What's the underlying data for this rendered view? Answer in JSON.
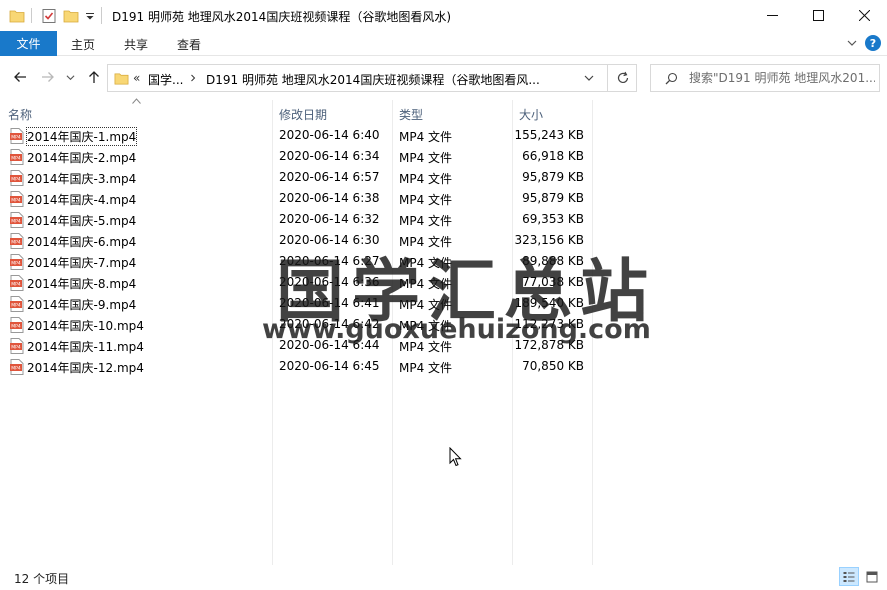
{
  "window": {
    "title": "D191 明师苑 地理风水2014国庆班视频课程（谷歌地图看风水)"
  },
  "ribbon": {
    "tabs": [
      "文件",
      "主页",
      "共享",
      "查看"
    ]
  },
  "address": {
    "overflow": "«",
    "crumbs": [
      "国学...",
      "D191 明师苑 地理风水2014国庆班视频课程（谷歌地图看风..."
    ]
  },
  "search": {
    "placeholder": "搜索\"D191 明师苑 地理风水201..."
  },
  "columns": {
    "name": "名称",
    "date": "修改日期",
    "type": "类型",
    "size": "大小"
  },
  "files": [
    {
      "name": "2014年国庆-1.mp4",
      "date": "2020-06-14 6:40",
      "type": "MP4 文件",
      "size": "155,243 KB"
    },
    {
      "name": "2014年国庆-2.mp4",
      "date": "2020-06-14 6:34",
      "type": "MP4 文件",
      "size": "66,918 KB"
    },
    {
      "name": "2014年国庆-3.mp4",
      "date": "2020-06-14 6:57",
      "type": "MP4 文件",
      "size": "95,879 KB"
    },
    {
      "name": "2014年国庆-4.mp4",
      "date": "2020-06-14 6:38",
      "type": "MP4 文件",
      "size": "95,879 KB"
    },
    {
      "name": "2014年国庆-5.mp4",
      "date": "2020-06-14 6:32",
      "type": "MP4 文件",
      "size": "69,353 KB"
    },
    {
      "name": "2014年国庆-6.mp4",
      "date": "2020-06-14 6:30",
      "type": "MP4 文件",
      "size": "323,156 KB"
    },
    {
      "name": "2014年国庆-7.mp4",
      "date": "2020-06-14 6:27",
      "type": "MP4 文件",
      "size": "89,888 KB"
    },
    {
      "name": "2014年国庆-8.mp4",
      "date": "2020-06-14 6:36",
      "type": "MP4 文件",
      "size": "77,038 KB"
    },
    {
      "name": "2014年国庆-9.mp4",
      "date": "2020-06-14 6:41",
      "type": "MP4 文件",
      "size": "189,540 KB"
    },
    {
      "name": "2014年国庆-10.mp4",
      "date": "2020-06-14 6:42",
      "type": "MP4 文件",
      "size": "112,273 KB"
    },
    {
      "name": "2014年国庆-11.mp4",
      "date": "2020-06-14 6:44",
      "type": "MP4 文件",
      "size": "172,878 KB"
    },
    {
      "name": "2014年国庆-12.mp4",
      "date": "2020-06-14 6:45",
      "type": "MP4 文件",
      "size": "70,850 KB"
    }
  ],
  "watermark": {
    "chinese": "国学汇总站",
    "url": "www.guoxuehuizong.com"
  },
  "status": {
    "count": "12 个项目"
  },
  "colors": {
    "file_tab": "#1979ca",
    "header_text": "#4c607a",
    "folder": "#f8d775"
  },
  "icons": {
    "title_bar": [
      "folder-icon",
      "properties-check-icon",
      "new-folder-icon",
      "customize-dropdown-icon"
    ],
    "nav": [
      "back-arrow-icon",
      "forward-arrow-icon",
      "recent-dropdown-icon",
      "up-arrow-icon"
    ],
    "window": [
      "minimize-icon",
      "maximize-icon",
      "close-icon"
    ],
    "file": "mp4-file-icon"
  }
}
